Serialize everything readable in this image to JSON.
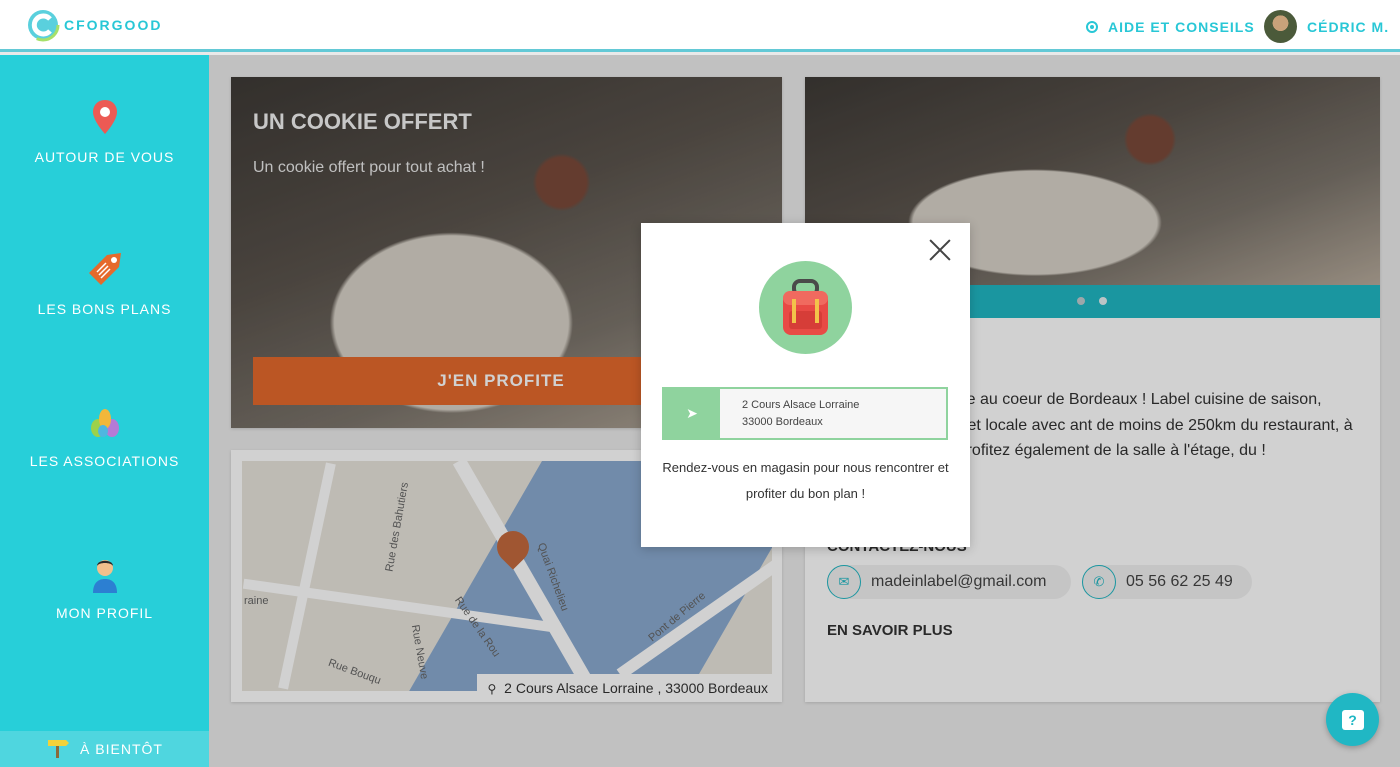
{
  "header": {
    "logo_text": "CFORGOOD",
    "help_label": "AIDE ET CONSEILS",
    "user_name": "CÉDRIC M."
  },
  "sidebar": {
    "items": [
      {
        "label": "AUTOUR DE VOUS",
        "icon": "location-pin-icon"
      },
      {
        "label": "LES BONS PLANS",
        "icon": "price-tag-icon"
      },
      {
        "label": "LES ASSOCIATIONS",
        "icon": "hands-icon"
      },
      {
        "label": "MON PROFIL",
        "icon": "user-icon"
      }
    ],
    "footer_label": "À BIENTÔT"
  },
  "deal": {
    "title": "UN COOKIE OFFERT",
    "subtitle": "Un cookie offert pour tout achat !",
    "cta_label": "J'EN PROFITE"
  },
  "map": {
    "address": "2 Cours Alsace Lorraine , 33000 Bordeaux",
    "labels": [
      "Rue des Bahutiers",
      "Quai Richelieu",
      "Rue de la Rou",
      "Rue Neuve",
      "Rue Bouqu",
      "Pont de Pierre",
      "raine"
    ]
  },
  "shop": {
    "info_text": "Street Food locavore au coeur de Bordeaux ! Label cuisine de saison, rapide, savoureuse et locale avec ant de moins de 250km du restaurant, à consommer orter. Profitez également de la salle à l'étage, du !",
    "contact_heading": "CONTACTEZ-NOUS",
    "email": "madeinlabel@gmail.com",
    "phone": "05 56 62 25 49",
    "more_label": "EN SAVOIR PLUS"
  },
  "modal": {
    "icon": "backpack-icon",
    "address_line1": "2 Cours Alsace Lorraine",
    "address_line2": "33000 Bordeaux",
    "message": "Rendez-vous en magasin pour nous rencontrer et profiter du bon plan !"
  },
  "colors": {
    "accent": "#27cfd9",
    "cta": "#e56a2c",
    "modal_green": "#8fd39e"
  }
}
